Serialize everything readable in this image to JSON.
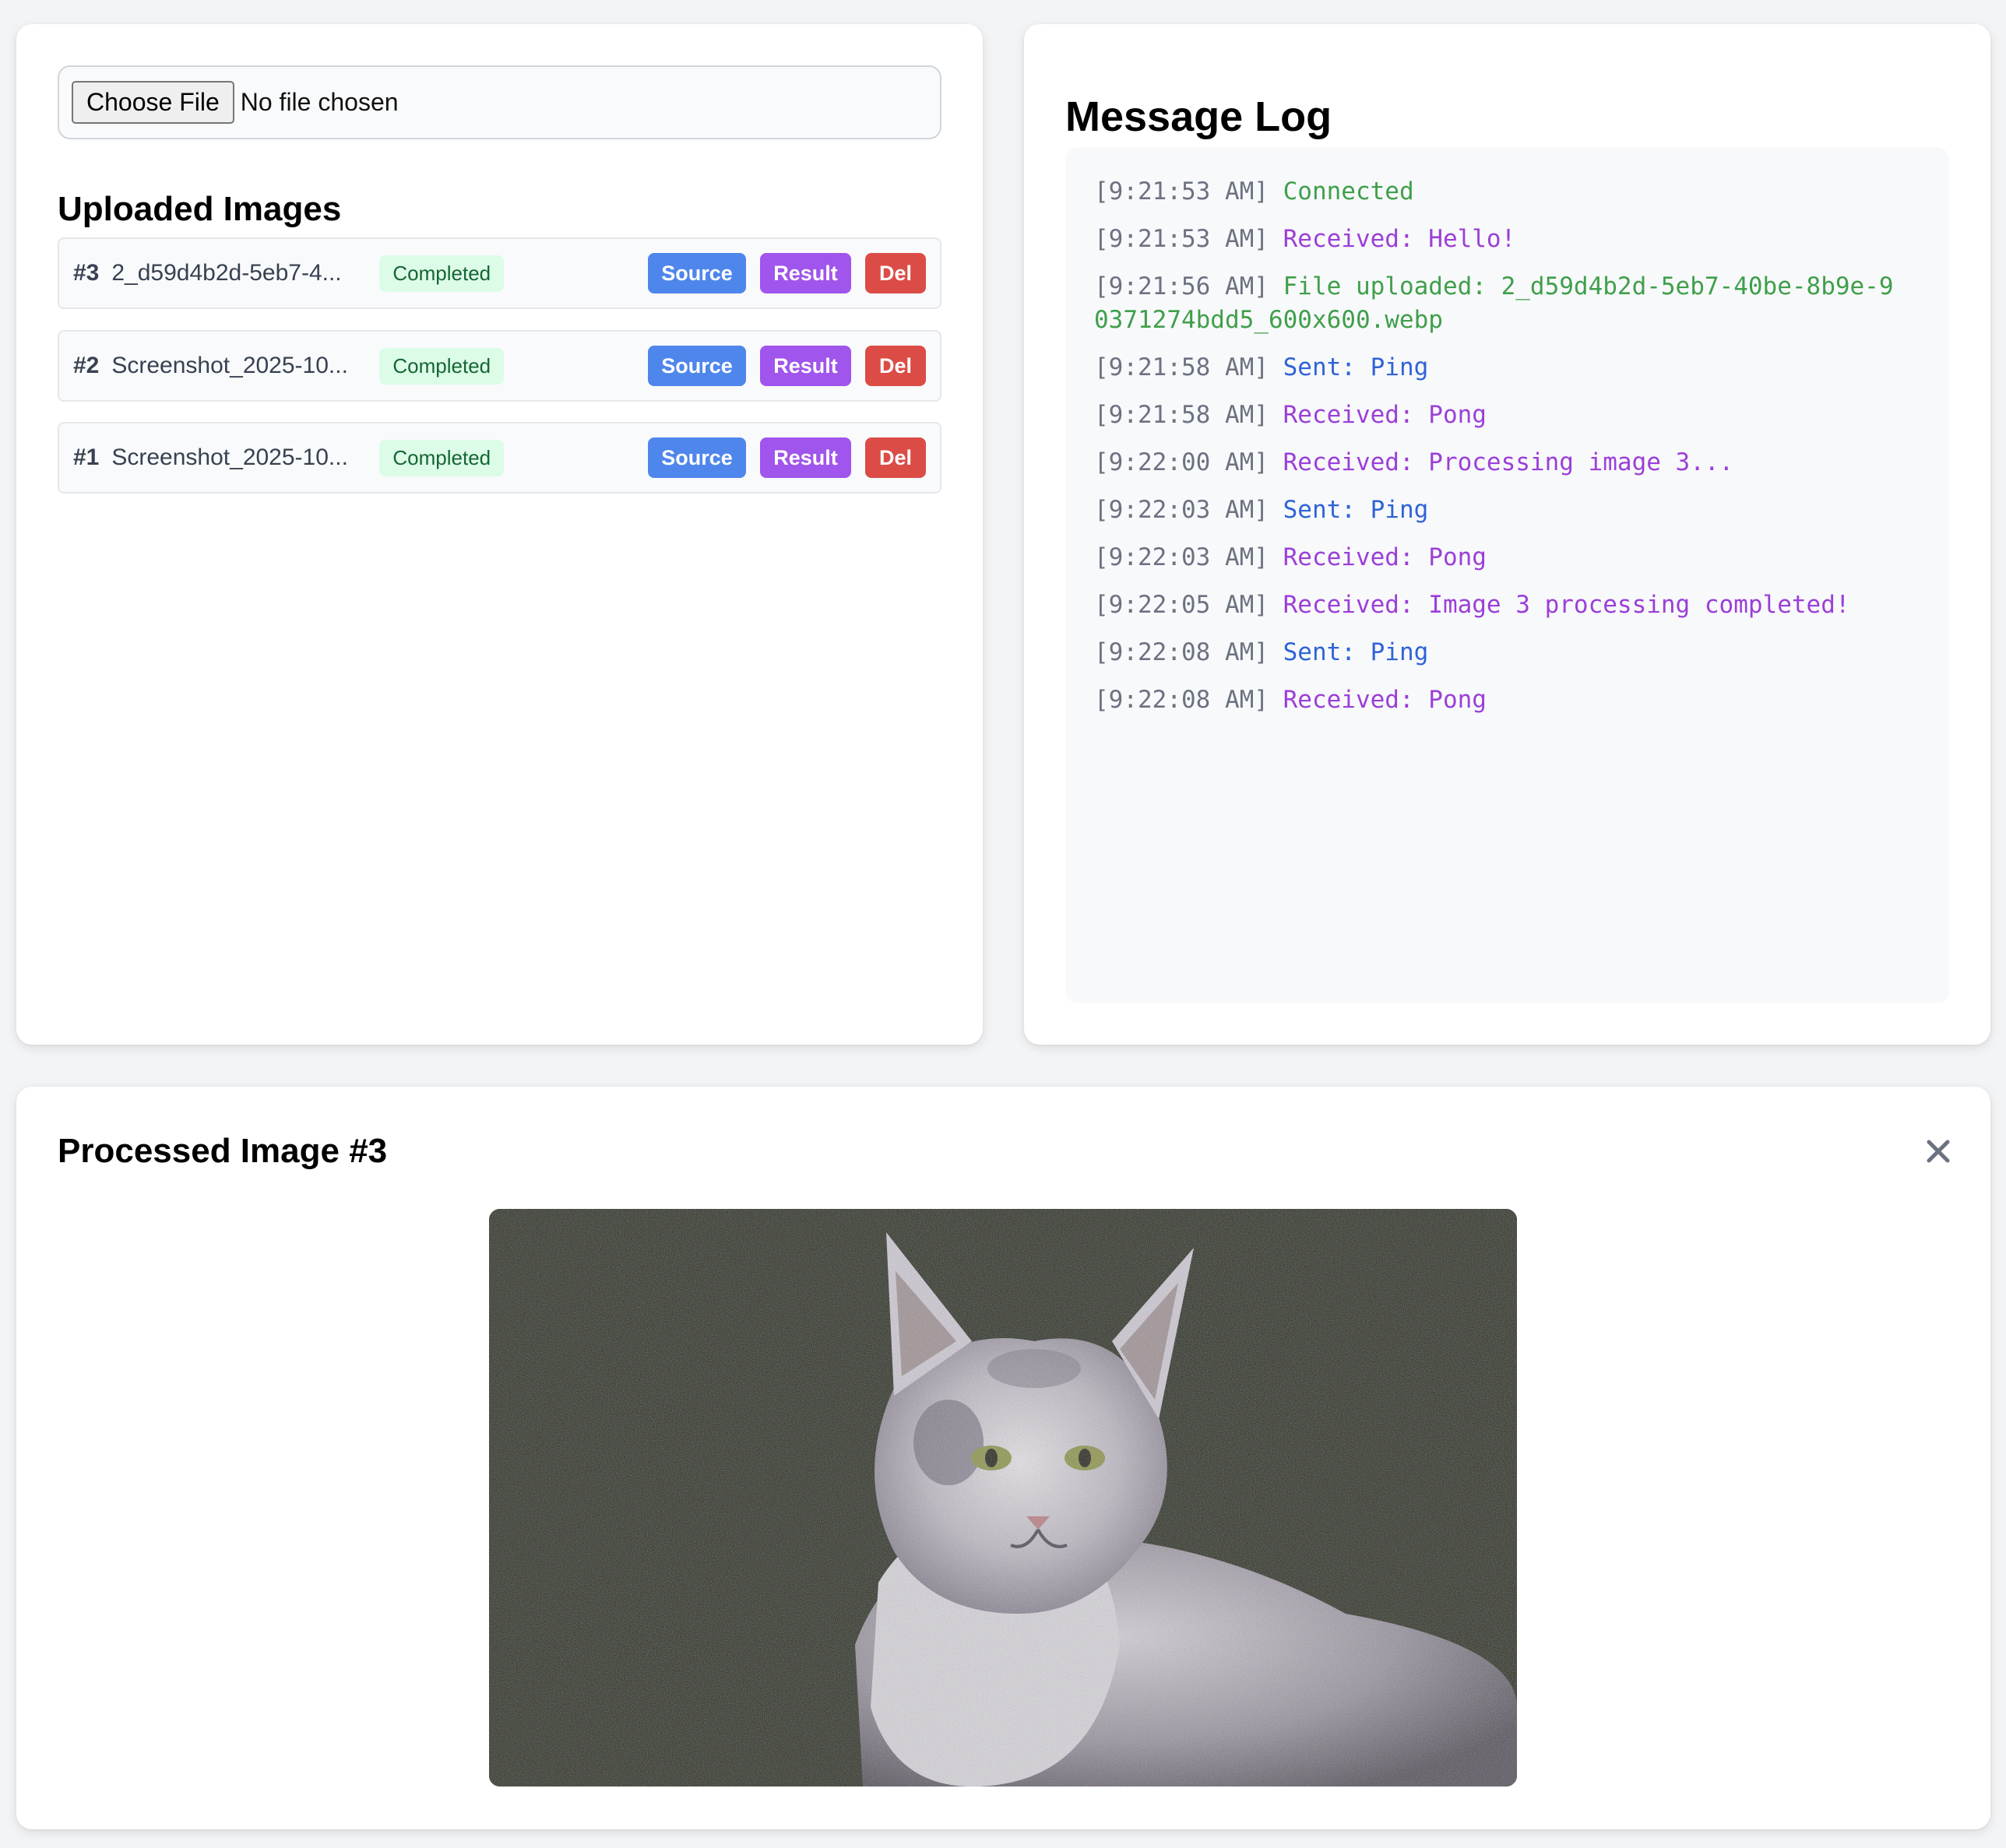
{
  "upload": {
    "choose_file_label": "Choose File",
    "no_file_text": "No file chosen",
    "title": "Uploaded Images",
    "images": [
      {
        "num": "#3",
        "name": "2_d59d4b2d-5eb7-4...",
        "status": "Completed",
        "source": "Source",
        "result": "Result",
        "del": "Del"
      },
      {
        "num": "#2",
        "name": "Screenshot_2025-10...",
        "status": "Completed",
        "source": "Source",
        "result": "Result",
        "del": "Del"
      },
      {
        "num": "#1",
        "name": "Screenshot_2025-10...",
        "status": "Completed",
        "source": "Source",
        "result": "Result",
        "del": "Del"
      }
    ]
  },
  "log": {
    "title": "Message Log",
    "entries": [
      {
        "ts": "[9:21:53 AM]",
        "msg": "Connected",
        "kind": "green"
      },
      {
        "ts": "[9:21:53 AM]",
        "msg": "Received: Hello!",
        "kind": "purple"
      },
      {
        "ts": "[9:21:56 AM]",
        "msg": "File uploaded: 2_d59d4b2d-5eb7-40be-8b9e-90371274bdd5_600x600.webp",
        "kind": "green"
      },
      {
        "ts": "[9:21:58 AM]",
        "msg": "Sent: Ping",
        "kind": "blue"
      },
      {
        "ts": "[9:21:58 AM]",
        "msg": "Received: Pong",
        "kind": "purple"
      },
      {
        "ts": "[9:22:00 AM]",
        "msg": "Received: Processing image 3...",
        "kind": "purple"
      },
      {
        "ts": "[9:22:03 AM]",
        "msg": "Sent: Ping",
        "kind": "blue"
      },
      {
        "ts": "[9:22:03 AM]",
        "msg": "Received: Pong",
        "kind": "purple"
      },
      {
        "ts": "[9:22:05 AM]",
        "msg": "Received: Image 3 processing completed!",
        "kind": "purple"
      },
      {
        "ts": "[9:22:08 AM]",
        "msg": "Sent: Ping",
        "kind": "blue"
      },
      {
        "ts": "[9:22:08 AM]",
        "msg": "Received: Pong",
        "kind": "purple"
      }
    ]
  },
  "processed": {
    "title": "Processed Image #3",
    "close_icon": "close-icon"
  },
  "colors": {
    "source": "#4f86ec",
    "result": "#a055ec",
    "del": "#dc4c46",
    "badge_bg": "#dcfce7",
    "badge_text": "#166534",
    "log_green": "#3f9f4a",
    "log_purple": "#9b3fd8",
    "log_blue": "#2f63d6"
  }
}
